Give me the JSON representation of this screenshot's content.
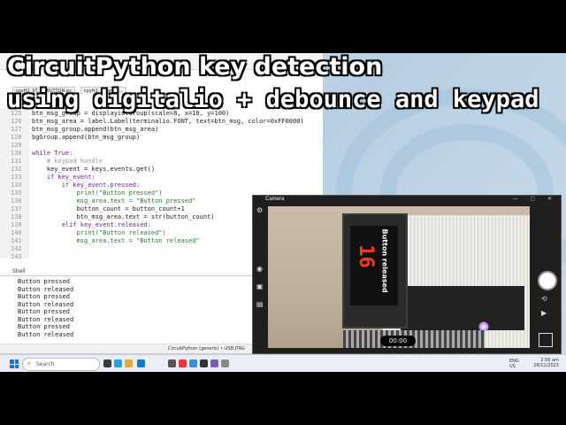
{
  "overlay": {
    "title_line1": "CircuitPython key detection",
    "title_line2": "using digitalio + debounce and keypad"
  },
  "thonny": {
    "tabs": [
      "cpyH2_ST...3_BUTTON.py",
      "cpyH2_... keypa..."
    ],
    "editor": {
      "lines": [
        {
          "n": "125",
          "t": "btn_msg_group = displayio.Group(scale=8, x=10, y=100)"
        },
        {
          "n": "126",
          "t": "btn_msg_area = label.Label(terminalio.FONT, text=btn_msg, color=0xFF0000)"
        },
        {
          "n": "127",
          "t": "btn_msg_group.append(btn_msg_area)"
        },
        {
          "n": "128",
          "t": "bgGroup.append(btn_msg_group)"
        },
        {
          "n": "129",
          "t": ""
        },
        {
          "n": "130",
          "t": "while True:"
        },
        {
          "n": "131",
          "t": "    # keypad handle"
        },
        {
          "n": "132",
          "t": "    key_event = keys.events.get()"
        },
        {
          "n": "133",
          "t": "    if key_event:"
        },
        {
          "n": "134",
          "t": "        if key_event.pressed:"
        },
        {
          "n": "135",
          "t": "            print(\"Button pressed\")"
        },
        {
          "n": "136",
          "t": "            msg_area.text = \"Button pressed\""
        },
        {
          "n": "137",
          "t": "            button_count = button_count+1"
        },
        {
          "n": "138",
          "t": "            btn_msg_area.text = str(button_count)"
        },
        {
          "n": "139",
          "t": "        elif key_event.released:"
        },
        {
          "n": "140",
          "t": "            print(\"Button released\")"
        },
        {
          "n": "141",
          "t": "            msg_area.text = \"Button released\""
        },
        {
          "n": "142",
          "t": ""
        },
        {
          "n": "143",
          "t": ""
        }
      ]
    },
    "shell_label": "Shell",
    "shell_lines": [
      "Button pressed",
      "Button released",
      "Button pressed",
      "Button released",
      "Button pressed",
      "Button released",
      "Button pressed",
      "Button released"
    ],
    "status": "CircuitPython (generic)  •  USB JTAG"
  },
  "camera": {
    "title": "Camera",
    "controls": "— ▢ ✕",
    "display_count": "16",
    "display_message": "Button released",
    "timer": "00:00"
  },
  "taskbar": {
    "search_placeholder": "Search",
    "lang": "ENG\nUS",
    "time": "2:56 am",
    "date": "28/11/2023"
  },
  "colors": {
    "accent": "#1e73d8",
    "code_number": "#1565c0",
    "display_count_red": "#ff3a1a"
  }
}
